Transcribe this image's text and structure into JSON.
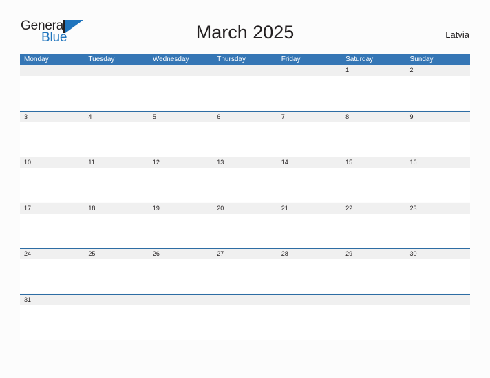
{
  "brand": {
    "name_part1": "General",
    "name_part2": "Blue",
    "triangle_icon": "triangle-right-icon",
    "accent_color": "#1f74bd"
  },
  "header": {
    "title": "March 2025",
    "country": "Latvia"
  },
  "calendar": {
    "header_bg": "#3576b5",
    "date_band_bg": "#f0f0f0",
    "separator_color": "#2e6da4",
    "weekdays": [
      "Monday",
      "Tuesday",
      "Wednesday",
      "Thursday",
      "Friday",
      "Saturday",
      "Sunday"
    ],
    "weeks": [
      [
        "",
        "",
        "",
        "",
        "",
        "1",
        "2"
      ],
      [
        "3",
        "4",
        "5",
        "6",
        "7",
        "8",
        "9"
      ],
      [
        "10",
        "11",
        "12",
        "13",
        "14",
        "15",
        "16"
      ],
      [
        "17",
        "18",
        "19",
        "20",
        "21",
        "22",
        "23"
      ],
      [
        "24",
        "25",
        "26",
        "27",
        "28",
        "29",
        "30"
      ],
      [
        "31",
        "",
        "",
        "",
        "",
        "",
        ""
      ]
    ]
  }
}
